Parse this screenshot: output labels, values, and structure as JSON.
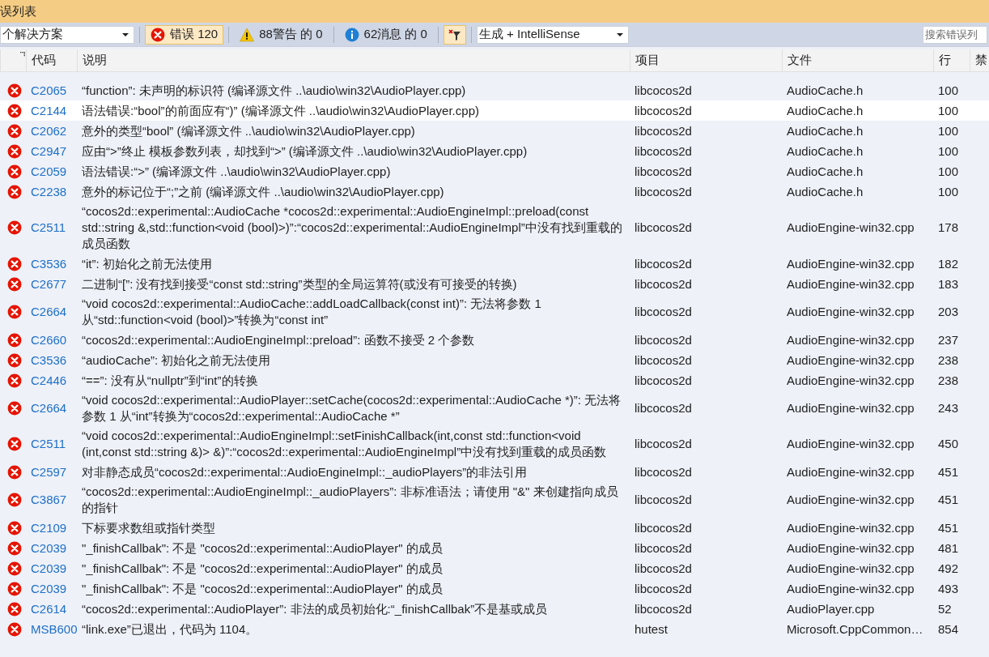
{
  "window": {
    "title": "误列表"
  },
  "toolbar": {
    "scope": {
      "value": "个解决方案"
    },
    "filters": [
      {
        "kind": "error",
        "label": "错误 120",
        "selected": true
      },
      {
        "kind": "warning",
        "label": "88警告 的 0",
        "selected": false
      },
      {
        "kind": "info",
        "label": "62消息 的 0",
        "selected": false
      }
    ],
    "filter_toggle": {
      "selected": true
    },
    "source": {
      "value": "生成 + IntelliSense"
    },
    "search": {
      "placeholder": "搜索错误列"
    }
  },
  "table": {
    "columns": [
      "代码",
      "说明",
      "项目",
      "文件",
      "行",
      "禁"
    ],
    "rows": [
      {
        "code": "C2065",
        "description": "“function”: 未声明的标识符 (编译源文件 ..\\audio\\win32\\AudioPlayer.cpp)",
        "project": "libcocos2d",
        "file": "AudioCache.h",
        "line": "100",
        "selected": false
      },
      {
        "code": "C2144",
        "description": "语法错误:“bool”的前面应有“)” (编译源文件 ..\\audio\\win32\\AudioPlayer.cpp)",
        "project": "libcocos2d",
        "file": "AudioCache.h",
        "line": "100",
        "selected": true
      },
      {
        "code": "C2062",
        "description": "意外的类型“bool” (编译源文件 ..\\audio\\win32\\AudioPlayer.cpp)",
        "project": "libcocos2d",
        "file": "AudioCache.h",
        "line": "100",
        "selected": false
      },
      {
        "code": "C2947",
        "description": "应由“>”终止 模板参数列表，却找到“>” (编译源文件 ..\\audio\\win32\\AudioPlayer.cpp)",
        "project": "libcocos2d",
        "file": "AudioCache.h",
        "line": "100",
        "selected": false
      },
      {
        "code": "C2059",
        "description": "语法错误:“>” (编译源文件 ..\\audio\\win32\\AudioPlayer.cpp)",
        "project": "libcocos2d",
        "file": "AudioCache.h",
        "line": "100",
        "selected": false
      },
      {
        "code": "C2238",
        "description": "意外的标记位于“;”之前 (编译源文件 ..\\audio\\win32\\AudioPlayer.cpp)",
        "project": "libcocos2d",
        "file": "AudioCache.h",
        "line": "100",
        "selected": false
      },
      {
        "code": "C2511",
        "description": "“cocos2d::experimental::AudioCache *cocos2d::experimental::AudioEngineImpl::preload(const std::string &,std::function<void (bool)>)”:“cocos2d::experimental::AudioEngineImpl”中没有找到重载的成员函数",
        "project": "libcocos2d",
        "file": "AudioEngine-win32.cpp",
        "line": "178",
        "selected": false
      },
      {
        "code": "C3536",
        "description": "“it”: 初始化之前无法使用",
        "project": "libcocos2d",
        "file": "AudioEngine-win32.cpp",
        "line": "182",
        "selected": false
      },
      {
        "code": "C2677",
        "description": "二进制“[”: 没有找到接受“const std::string”类型的全局运算符(或没有可接受的转换)",
        "project": "libcocos2d",
        "file": "AudioEngine-win32.cpp",
        "line": "183",
        "selected": false
      },
      {
        "code": "C2664",
        "description": "“void cocos2d::experimental::AudioCache::addLoadCallback(const int)”: 无法将参数 1 从“std::function<void (bool)>”转换为“const int”",
        "project": "libcocos2d",
        "file": "AudioEngine-win32.cpp",
        "line": "203",
        "selected": false
      },
      {
        "code": "C2660",
        "description": "“cocos2d::experimental::AudioEngineImpl::preload”: 函数不接受 2 个参数",
        "project": "libcocos2d",
        "file": "AudioEngine-win32.cpp",
        "line": "237",
        "selected": false
      },
      {
        "code": "C3536",
        "description": "“audioCache”: 初始化之前无法使用",
        "project": "libcocos2d",
        "file": "AudioEngine-win32.cpp",
        "line": "238",
        "selected": false
      },
      {
        "code": "C2446",
        "description": "“==”: 没有从“nullptr”到“int”的转换",
        "project": "libcocos2d",
        "file": "AudioEngine-win32.cpp",
        "line": "238",
        "selected": false
      },
      {
        "code": "C2664",
        "description": "“void cocos2d::experimental::AudioPlayer::setCache(cocos2d::experimental::AudioCache *)”: 无法将参数 1 从“int”转换为“cocos2d::experimental::AudioCache *”",
        "project": "libcocos2d",
        "file": "AudioEngine-win32.cpp",
        "line": "243",
        "selected": false
      },
      {
        "code": "C2511",
        "description": "“void cocos2d::experimental::AudioEngineImpl::setFinishCallback(int,const std::function<void (int,const std::string &)> &)”:“cocos2d::experimental::AudioEngineImpl”中没有找到重载的成员函数",
        "project": "libcocos2d",
        "file": "AudioEngine-win32.cpp",
        "line": "450",
        "selected": false
      },
      {
        "code": "C2597",
        "description": "对非静态成员“cocos2d::experimental::AudioEngineImpl::_audioPlayers”的非法引用",
        "project": "libcocos2d",
        "file": "AudioEngine-win32.cpp",
        "line": "451",
        "selected": false
      },
      {
        "code": "C3867",
        "description": "“cocos2d::experimental::AudioEngineImpl::_audioPlayers”: 非标准语法；请使用 \"&\" 来创建指向成员的指针",
        "project": "libcocos2d",
        "file": "AudioEngine-win32.cpp",
        "line": "451",
        "selected": false
      },
      {
        "code": "C2109",
        "description": "下标要求数组或指针类型",
        "project": "libcocos2d",
        "file": "AudioEngine-win32.cpp",
        "line": "451",
        "selected": false
      },
      {
        "code": "C2039",
        "description": "\"_finishCallbak\": 不是 \"cocos2d::experimental::AudioPlayer\" 的成员",
        "project": "libcocos2d",
        "file": "AudioEngine-win32.cpp",
        "line": "481",
        "selected": false
      },
      {
        "code": "C2039",
        "description": "\"_finishCallbak\": 不是 \"cocos2d::experimental::AudioPlayer\" 的成员",
        "project": "libcocos2d",
        "file": "AudioEngine-win32.cpp",
        "line": "492",
        "selected": false
      },
      {
        "code": "C2039",
        "description": "\"_finishCallbak\": 不是 \"cocos2d::experimental::AudioPlayer\" 的成员",
        "project": "libcocos2d",
        "file": "AudioEngine-win32.cpp",
        "line": "493",
        "selected": false
      },
      {
        "code": "C2614",
        "description": "“cocos2d::experimental::AudioPlayer”: 非法的成员初始化:“_finishCallbak”不是基或成员",
        "project": "libcocos2d",
        "file": "AudioPlayer.cpp",
        "line": "52",
        "selected": false
      },
      {
        "code": "MSB600",
        "description": "“link.exe”已退出，代码为 1104。",
        "project": "hutest",
        "file": "Microsoft.CppCommon…",
        "line": "854",
        "selected": false
      }
    ]
  }
}
